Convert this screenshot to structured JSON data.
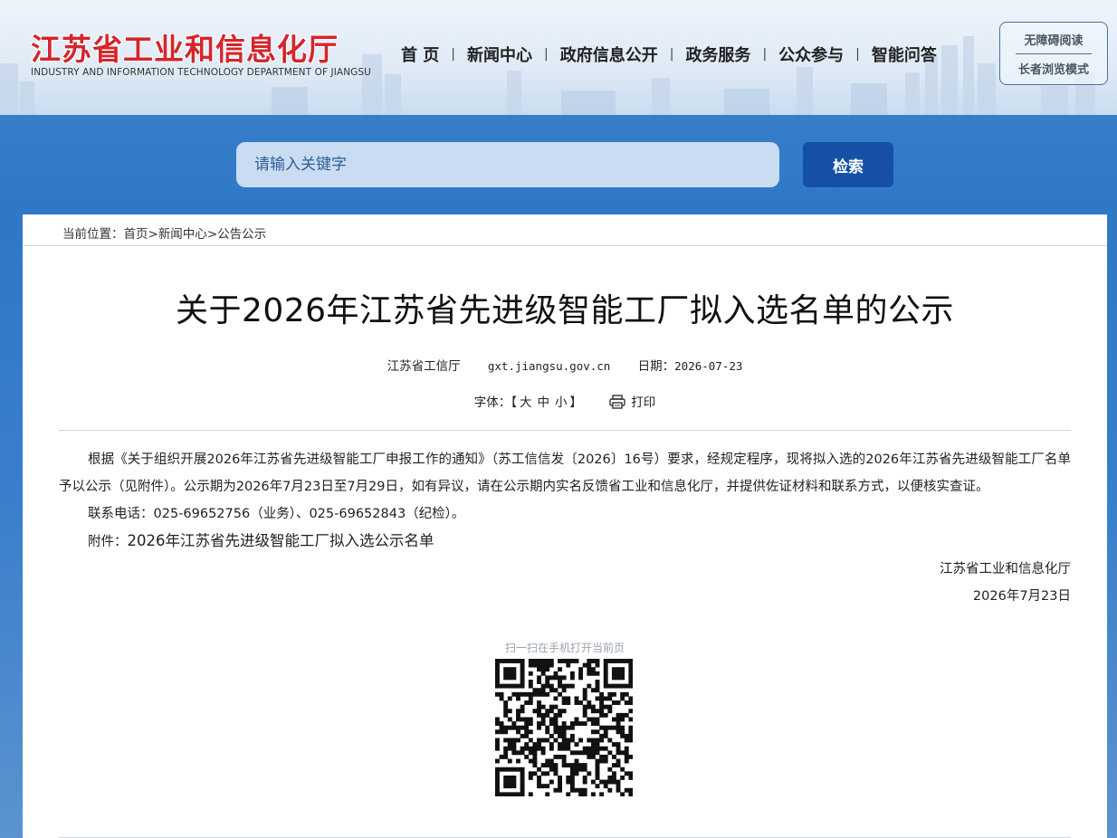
{
  "header": {
    "logo_cn": "江苏省工业和信息化厅",
    "logo_en": "INDUSTRY AND INFORMATION TECHNOLOGY DEPARTMENT OF JIANGSU",
    "nav": [
      "首 页",
      "新闻中心",
      "政府信息公开",
      "政务服务",
      "公众参与",
      "智能问答"
    ],
    "nav_separator": "|",
    "accessibility": {
      "barrier_free": "无障碍阅读",
      "elder_mode": "长者浏览模式"
    }
  },
  "search": {
    "placeholder": "请输入关键字",
    "button": "检索"
  },
  "breadcrumb": {
    "prefix": "当前位置：",
    "items": [
      "首页",
      "新闻中心",
      "公告公示"
    ],
    "separator": ">"
  },
  "article": {
    "title": "关于2026年江苏省先进级智能工厂拟入选名单的公示",
    "source": "江苏省工信厅",
    "site": "gxt.jiangsu.gov.cn",
    "date_label": "日期：",
    "date": "2026-07-23",
    "font_label": "字体：",
    "font_open": "【",
    "font_sizes": [
      "大",
      "中",
      "小"
    ],
    "font_close": "】",
    "print": "打印",
    "paragraph1": "根据《关于组织开展2026年江苏省先进级智能工厂申报工作的通知》（苏工信信发〔2026〕16号）要求，经规定程序，现将拟入选的2026年江苏省先进级智能工厂名单予以公示（见附件）。公示期为2026年7月23日至7月29日，如有异议，请在公示期内实名反馈省工业和信息化厅，并提供佐证材料和联系方式，以便核实查证。",
    "contact": "联系电话：025-69652756（业务）、025-69652843（纪检）。",
    "attachment_label": "附件：",
    "attachment": "2026年江苏省先进级智能工厂拟入选公示名单",
    "signature_org": "江苏省工业和信息化厅",
    "signature_date": "2026年7月23日"
  },
  "qr": {
    "label": "扫一扫在手机打开当前页"
  },
  "colors": {
    "logo_red": "#d3262c",
    "search_button": "#1550a6",
    "search_field": "#c9dcf1",
    "page_blue": "#3a7fcb"
  }
}
